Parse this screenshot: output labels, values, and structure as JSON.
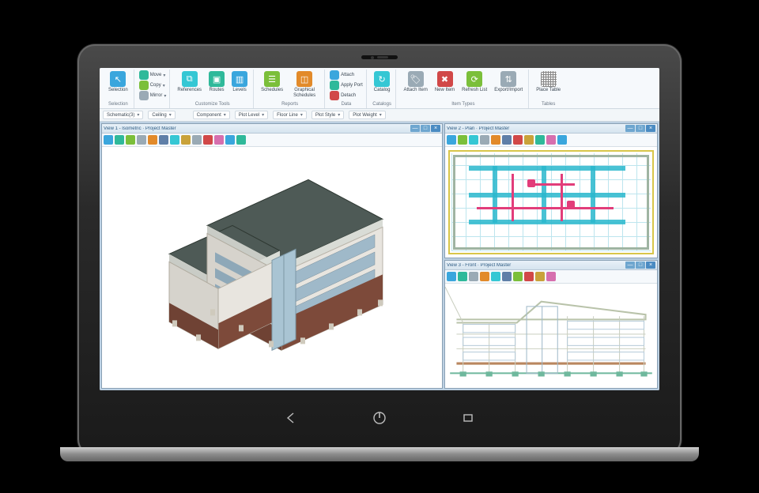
{
  "ribbon": {
    "groups": {
      "selection": {
        "label": "Selection",
        "buttons": [
          "Selection"
        ]
      },
      "clipboard": {
        "label": "",
        "lines": [
          "Move",
          "Copy",
          "Mirror"
        ]
      },
      "customize": {
        "label": "Customize Tools",
        "buttons": [
          "References",
          "Routes",
          "Levels"
        ]
      },
      "reports": {
        "label": "Reports",
        "buttons": [
          "Schedules",
          "Graphical Schedules"
        ]
      },
      "data": {
        "label": "Data",
        "lines": [
          "Attach",
          "Apply Port",
          "Detach"
        ]
      },
      "catalogs": {
        "label": "Catalogs",
        "buttons": [
          "Catalog"
        ]
      },
      "item_types": {
        "label": "Item Types",
        "buttons": [
          "Attach Item",
          "New Item",
          "Refresh List",
          "Export/Import"
        ]
      },
      "tables": {
        "label": "Tables",
        "buttons": [
          "Place Table"
        ]
      }
    }
  },
  "toolbar2": {
    "breadcrumbs": [
      "Schematic(3)",
      "Ceiling"
    ],
    "fields": {
      "component": "Component",
      "plot_level": "Plot Level",
      "floor_line": "Floor Line",
      "plot_style": "Plot Style",
      "plot_weight": "Plot Weight"
    }
  },
  "views": {
    "main": {
      "title": "View 1 - Isometric · Project Master"
    },
    "plan": {
      "title": "View 2 - Plan · Project Master"
    },
    "elev": {
      "title": "View 3 - Front · Project Master"
    }
  },
  "icons": {
    "back": "◁",
    "power": "⏻",
    "menu": "▭"
  }
}
